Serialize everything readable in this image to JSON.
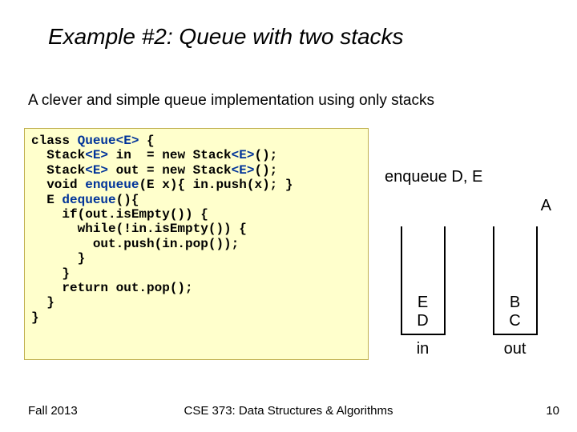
{
  "title": "Example #2: Queue with two stacks",
  "subtitle": "A clever and simple queue implementation using only stacks",
  "code": {
    "l1a": "class ",
    "l1b": "Queue<E>",
    "l1c": " {",
    "l2a": "  Stack",
    "l2b": "<E>",
    "l2c": " in  = new Stack",
    "l2d": "<E>",
    "l2e": "();",
    "l3a": "  Stack",
    "l3b": "<E>",
    "l3c": " out = new Stack",
    "l3d": "<E>",
    "l3e": "();",
    "l4a": "  void ",
    "l4b": "enqueue",
    "l4c": "(E x){ in.push(x); }",
    "l5a": "  E ",
    "l5b": "dequeue",
    "l5c": "(){",
    "l6": "    if(out.isEmpty()) {",
    "l7": "      while(!in.isEmpty()) {",
    "l8": "        out.push(in.pop());",
    "l9": "      }",
    "l10": "    }",
    "l11": "    return out.pop();",
    "l12": "  }",
    "l13": "}"
  },
  "diagram": {
    "op": "enqueue D, E",
    "top_letter": "A",
    "in_stack": [
      "E",
      "D"
    ],
    "out_stack": [
      "B",
      "C"
    ],
    "in_label": "in",
    "out_label": "out"
  },
  "footer": {
    "left": "Fall 2013",
    "center": "CSE 373: Data Structures & Algorithms",
    "page": "10"
  }
}
